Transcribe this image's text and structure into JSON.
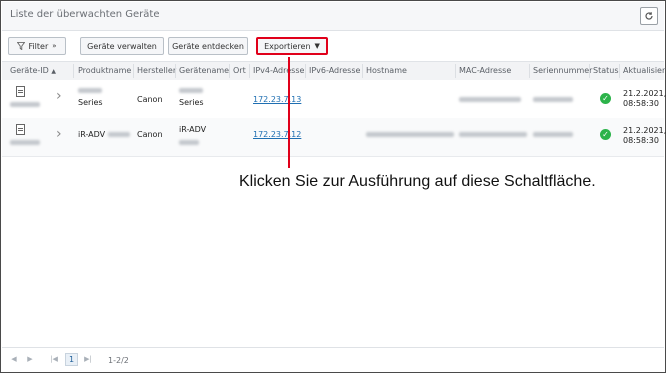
{
  "window": {
    "title": "Liste der überwachten Geräte"
  },
  "toolbar": {
    "filter_label": "Filter",
    "manage_label": "Geräte verwalten",
    "discover_label": "Geräte entdecken",
    "export_label": "Exportieren"
  },
  "columns": {
    "device_id": "Geräte-ID",
    "product_name": "Produktname",
    "manufacturer": "Hersteller",
    "device_name": "Gerätename",
    "location": "Ort",
    "ipv4": "IPv4-Adresse",
    "ipv6": "IPv6-Adresse",
    "hostname": "Hostname",
    "mac": "MAC-Adresse",
    "serial": "Seriennummer",
    "status": "Status",
    "updated": "Aktualisiert"
  },
  "rows": [
    {
      "product_name": "Series",
      "manufacturer": "Canon",
      "device_name": "Series",
      "ipv4": "172.23.7.13",
      "updated_date": "21.2.2021,",
      "updated_time": "08:58:30"
    },
    {
      "product_name": "iR-ADV",
      "manufacturer": "Canon",
      "device_name": "iR-ADV",
      "ipv4": "172.23.7.12",
      "updated_date": "21.2.2021,",
      "updated_time": "08:58:30"
    }
  ],
  "annotation": {
    "text": "Klicken Sie zur Ausführung auf diese Schaltfläche."
  },
  "pagination": {
    "page": "1",
    "info": "1-2/2"
  },
  "colors": {
    "highlight": "#e0001a",
    "status_ok": "#2cb34a",
    "link": "#1f6fb2"
  }
}
